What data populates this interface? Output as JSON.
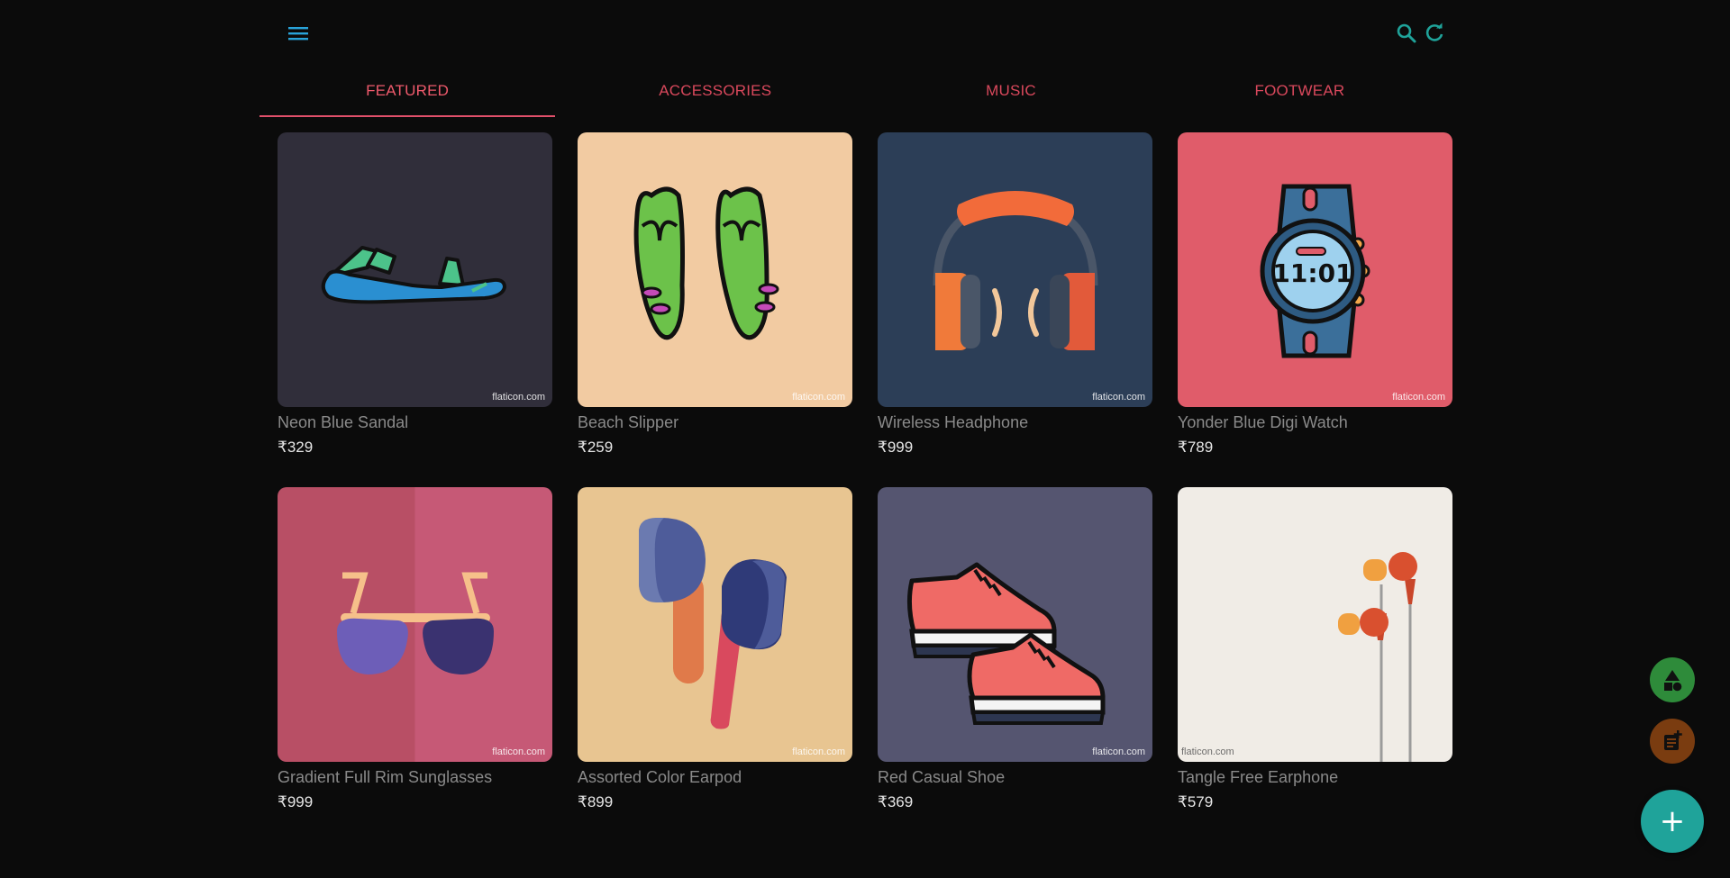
{
  "tabs": [
    {
      "label": "FEATURED"
    },
    {
      "label": "ACCESSORIES"
    },
    {
      "label": "MUSIC"
    },
    {
      "label": "FOOTWEAR"
    }
  ],
  "products": [
    {
      "name": "Neon Blue Sandal",
      "price": "₹329",
      "watermark": "flaticon.com",
      "bg": "#302e3a",
      "icon": "sandal-icon"
    },
    {
      "name": "Beach Slipper",
      "price": "₹259",
      "watermark": "flaticon.com",
      "bg": "#f2cba2",
      "icon": "flip-flops-icon"
    },
    {
      "name": "Wireless Headphone",
      "price": "₹999",
      "watermark": "flaticon.com",
      "bg": "#2c3e57",
      "icon": "headphones-icon"
    },
    {
      "name": "Yonder Blue Digi Watch",
      "price": "₹789",
      "watermark": "flaticon.com",
      "watch_time": "11:01",
      "bg": "#e05c6a",
      "icon": "smartwatch-icon"
    },
    {
      "name": "Gradient Full Rim Sunglasses",
      "price": "₹999",
      "watermark": "flaticon.com",
      "bg": "#c65976",
      "icon": "sunglasses-icon"
    },
    {
      "name": "Assorted Color Earpod",
      "price": "₹899",
      "watermark": "flaticon.com",
      "bg": "#e8c591",
      "icon": "earpods-icon"
    },
    {
      "name": "Red Casual Shoe",
      "price": "₹369",
      "watermark": "flaticon.com",
      "bg": "#555570",
      "icon": "sneakers-icon"
    },
    {
      "name": "Tangle Free Earphone",
      "price": "₹579",
      "watermark": "flaticon.com",
      "bg": "#f0ece6",
      "icon": "earphones-icon"
    }
  ],
  "fab": {
    "add_label": "+"
  },
  "colors": {
    "accent": "#1fa39a",
    "tab_text": "#d9485c",
    "tab_indicator": "#e0506a",
    "icon_blue": "#29a3d9"
  }
}
